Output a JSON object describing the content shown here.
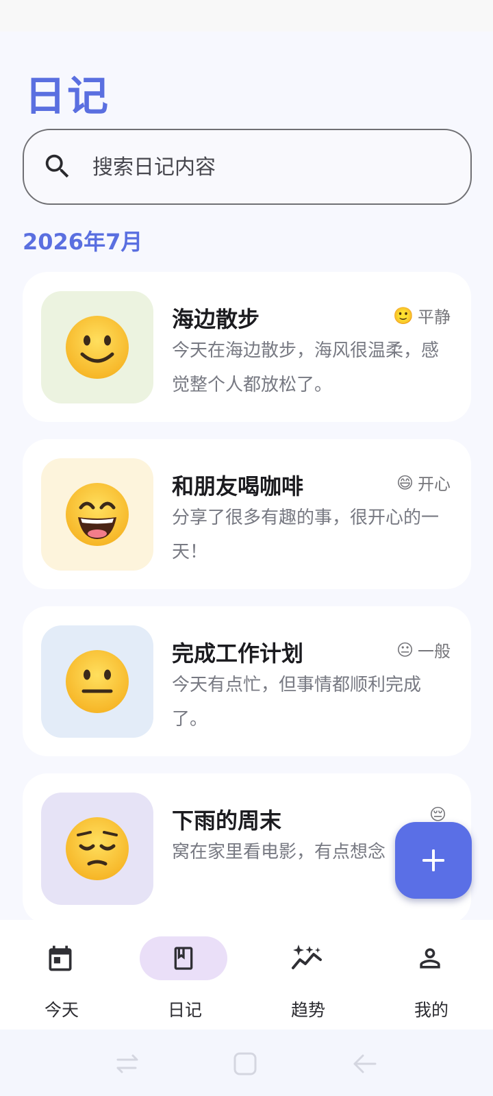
{
  "app": {
    "title": "日记"
  },
  "search": {
    "placeholder": "搜索日记内容"
  },
  "month_header": "2026年7月",
  "entries": [
    {
      "thumb_emoji": "🙂",
      "thumb_bg": "#ecf3e0",
      "title": "海边散步",
      "mood_emoji": "🙂",
      "mood_label": "平静",
      "preview": "今天在海边散步，海风很温柔，感觉整个人都放松了。"
    },
    {
      "thumb_emoji": "😄",
      "thumb_bg": "#fdf4dc",
      "title": "和朋友喝咖啡",
      "mood_emoji": "😄",
      "mood_label": "开心",
      "preview": "分享了很多有趣的事，很开心的一天！"
    },
    {
      "thumb_emoji": "😐",
      "thumb_bg": "#e3ecf8",
      "title": "完成工作计划",
      "mood_emoji": "😐",
      "mood_label": "一般",
      "preview": "今天有点忙，但事情都顺利完成了。"
    },
    {
      "thumb_emoji": "😔",
      "thumb_bg": "#e6e3f6",
      "title": "下雨的周末",
      "mood_emoji": "😔",
      "mood_label": "",
      "preview": "窝在家里看电影，有点想念"
    }
  ],
  "fab": {
    "icon": "plus-icon"
  },
  "bottom_nav": [
    {
      "label": "今天",
      "icon": "calendar-icon",
      "active": false
    },
    {
      "label": "日记",
      "icon": "journal-icon",
      "active": true
    },
    {
      "label": "趋势",
      "icon": "sparkle-trend-icon",
      "active": false
    },
    {
      "label": "我的",
      "icon": "person-icon",
      "active": false
    }
  ],
  "colors": {
    "accent": "#5a6fe0",
    "fab": "#5a6fe6",
    "active_pill": "#eadff8"
  }
}
